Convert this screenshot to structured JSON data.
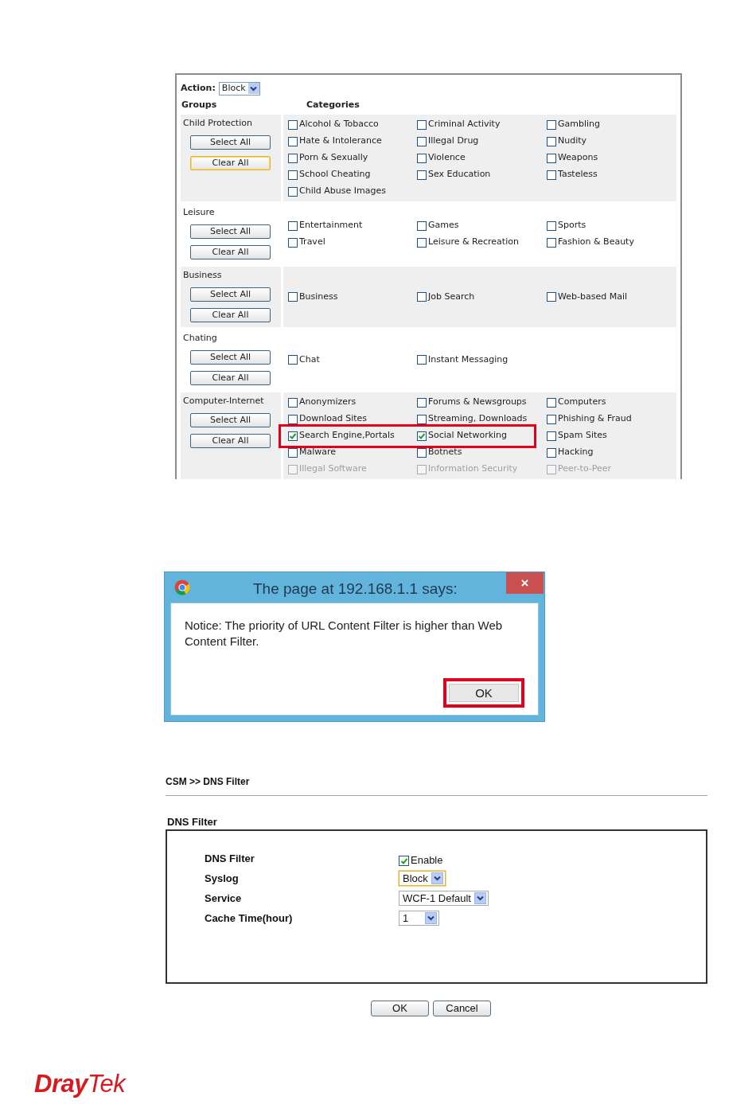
{
  "category_panel": {
    "action": {
      "label": "Action:",
      "value": "Block"
    },
    "headers": [
      "Groups",
      "Categories"
    ],
    "groups": [
      {
        "name": "Child Protection",
        "buttons": [
          {
            "label": "Select All",
            "focused": false
          },
          {
            "label": "Clear All",
            "focused": true
          }
        ],
        "categories": [
          {
            "label": "Alcohol & Tobacco",
            "checked": false
          },
          {
            "label": "Criminal Activity",
            "checked": false
          },
          {
            "label": "Gambling",
            "checked": false
          },
          {
            "label": "Hate & Intolerance",
            "checked": false
          },
          {
            "label": "Illegal Drug",
            "checked": false
          },
          {
            "label": "Nudity",
            "checked": false
          },
          {
            "label": "Porn & Sexually",
            "checked": false
          },
          {
            "label": "Violence",
            "checked": false
          },
          {
            "label": "Weapons",
            "checked": false
          },
          {
            "label": "School Cheating",
            "checked": false
          },
          {
            "label": "Sex Education",
            "checked": false
          },
          {
            "label": "Tasteless",
            "checked": false
          },
          {
            "label": "Child Abuse Images",
            "checked": false
          }
        ]
      },
      {
        "name": "Leisure",
        "buttons": [
          {
            "label": "Select All",
            "focused": false
          },
          {
            "label": "Clear All",
            "focused": false
          }
        ],
        "categories": [
          {
            "label": "Entertainment",
            "checked": false
          },
          {
            "label": "Games",
            "checked": false
          },
          {
            "label": "Sports",
            "checked": false
          },
          {
            "label": "Travel",
            "checked": false
          },
          {
            "label": "Leisure & Recreation",
            "checked": false
          },
          {
            "label": "Fashion & Beauty",
            "checked": false
          }
        ]
      },
      {
        "name": "Business",
        "buttons": [
          {
            "label": "Select All",
            "focused": false
          },
          {
            "label": "Clear All",
            "focused": false
          }
        ],
        "categories": [
          {
            "label": "Business",
            "checked": false
          },
          {
            "label": "Job Search",
            "checked": false
          },
          {
            "label": "Web-based Mail",
            "checked": false
          }
        ]
      },
      {
        "name": "Chating",
        "buttons": [
          {
            "label": "Select All",
            "focused": false
          },
          {
            "label": "Clear All",
            "focused": false
          }
        ],
        "categories": [
          {
            "label": "Chat",
            "checked": false
          },
          {
            "label": "Instant Messaging",
            "checked": false
          }
        ]
      },
      {
        "name": "Computer-Internet",
        "buttons": [
          {
            "label": "Select All",
            "focused": false
          },
          {
            "label": "Clear All",
            "focused": false
          }
        ],
        "categories": [
          {
            "label": "Anonymizers",
            "checked": false
          },
          {
            "label": "Forums & Newsgroups",
            "checked": false
          },
          {
            "label": "Computers",
            "checked": false
          },
          {
            "label": "Download Sites",
            "checked": false
          },
          {
            "label": "Streaming, Downloads",
            "checked": false
          },
          {
            "label": "Phishing & Fraud",
            "checked": false
          },
          {
            "label": "Search Engine,Portals",
            "checked": true
          },
          {
            "label": "Social Networking",
            "checked": true
          },
          {
            "label": "Spam Sites",
            "checked": false
          },
          {
            "label": "Malware",
            "checked": false
          },
          {
            "label": "Botnets",
            "checked": false
          },
          {
            "label": "Hacking",
            "checked": false
          },
          {
            "label": "Illegal Software",
            "checked": false
          },
          {
            "label": "Information Security",
            "checked": false
          },
          {
            "label": "Peer-to-Peer",
            "checked": false
          }
        ]
      }
    ]
  },
  "dialog": {
    "title": "The page at 192.168.1.1 says:",
    "close": "×",
    "message": "Notice: The priority of URL Content Filter is higher than Web Content Filter.",
    "button": "OK"
  },
  "dns_page": {
    "breadcrumb": "CSM >> DNS Filter",
    "section_title": "DNS Filter",
    "fields": [
      {
        "kind": "checkbox",
        "label": "DNS Filter",
        "option": "Enable",
        "checked": true
      },
      {
        "kind": "select",
        "label": "Syslog",
        "value": "Block",
        "focused": true
      },
      {
        "kind": "select",
        "label": "Service",
        "value": "WCF-1 Default",
        "focused": false
      },
      {
        "kind": "select",
        "label": "Cache Time(hour)",
        "value": "1",
        "focused": false
      }
    ],
    "buttons": [
      "OK",
      "Cancel"
    ]
  },
  "logo": "**Dray**Tek"
}
